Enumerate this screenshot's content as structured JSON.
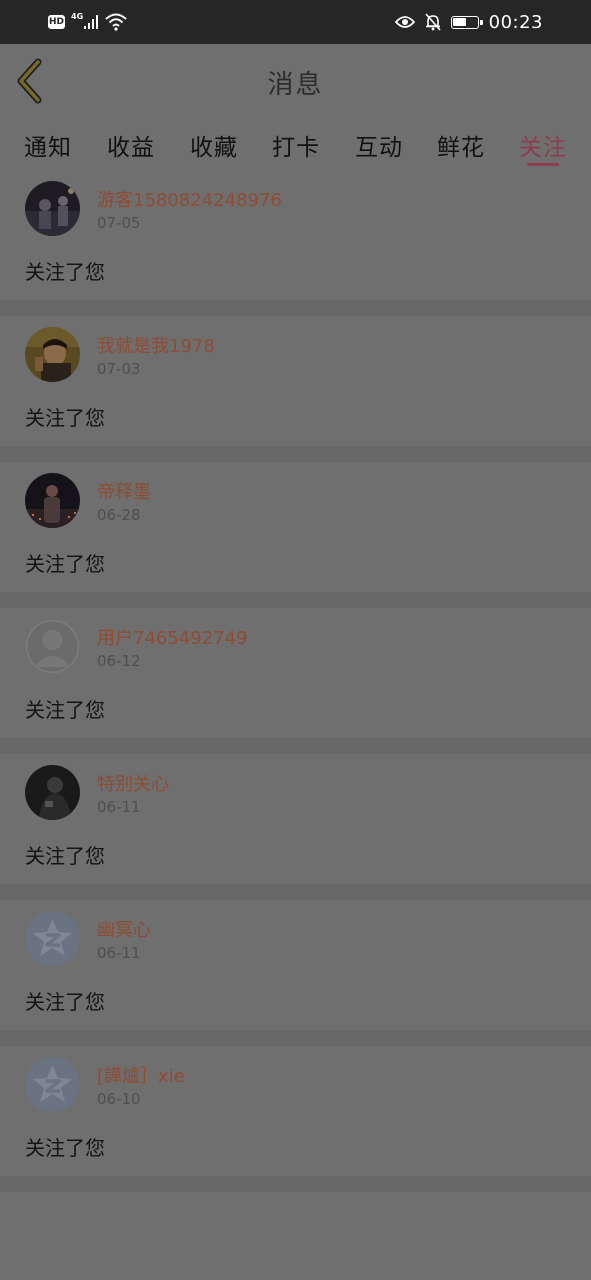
{
  "status_bar": {
    "hd_label": "HD",
    "network_label": "4G",
    "time": "00:23",
    "battery_level": 0.6
  },
  "header": {
    "title": "消息"
  },
  "tabs": [
    {
      "label": "通知",
      "active": false
    },
    {
      "label": "收益",
      "active": false
    },
    {
      "label": "收藏",
      "active": false
    },
    {
      "label": "打卡",
      "active": false
    },
    {
      "label": "互动",
      "active": false
    },
    {
      "label": "鲜花",
      "active": false
    },
    {
      "label": "关注",
      "active": true
    }
  ],
  "colors": {
    "accent": "#8f3c50",
    "username": "#8f4c33"
  },
  "notifications": [
    {
      "username": "游客1580824248976",
      "date": "07-05",
      "message": "关注了您",
      "avatar": "photo-night-people"
    },
    {
      "username": "我就是我1978",
      "date": "07-03",
      "message": "关注了您",
      "avatar": "photo-portrait-man"
    },
    {
      "username": "帝释墨",
      "date": "06-28",
      "message": "关注了您",
      "avatar": "photo-night-city"
    },
    {
      "username": "用户7465492749",
      "date": "06-12",
      "message": "关注了您",
      "avatar": "default-person-icon"
    },
    {
      "username": "特别关心",
      "date": "06-11",
      "message": "关注了您",
      "avatar": "photo-dark-figure"
    },
    {
      "username": "幽冥心",
      "date": "06-11",
      "message": "关注了您",
      "avatar": "qq-star-icon"
    },
    {
      "username": "[譁爐］xie",
      "date": "06-10",
      "message": "关注了您",
      "avatar": "qq-star-icon"
    }
  ]
}
